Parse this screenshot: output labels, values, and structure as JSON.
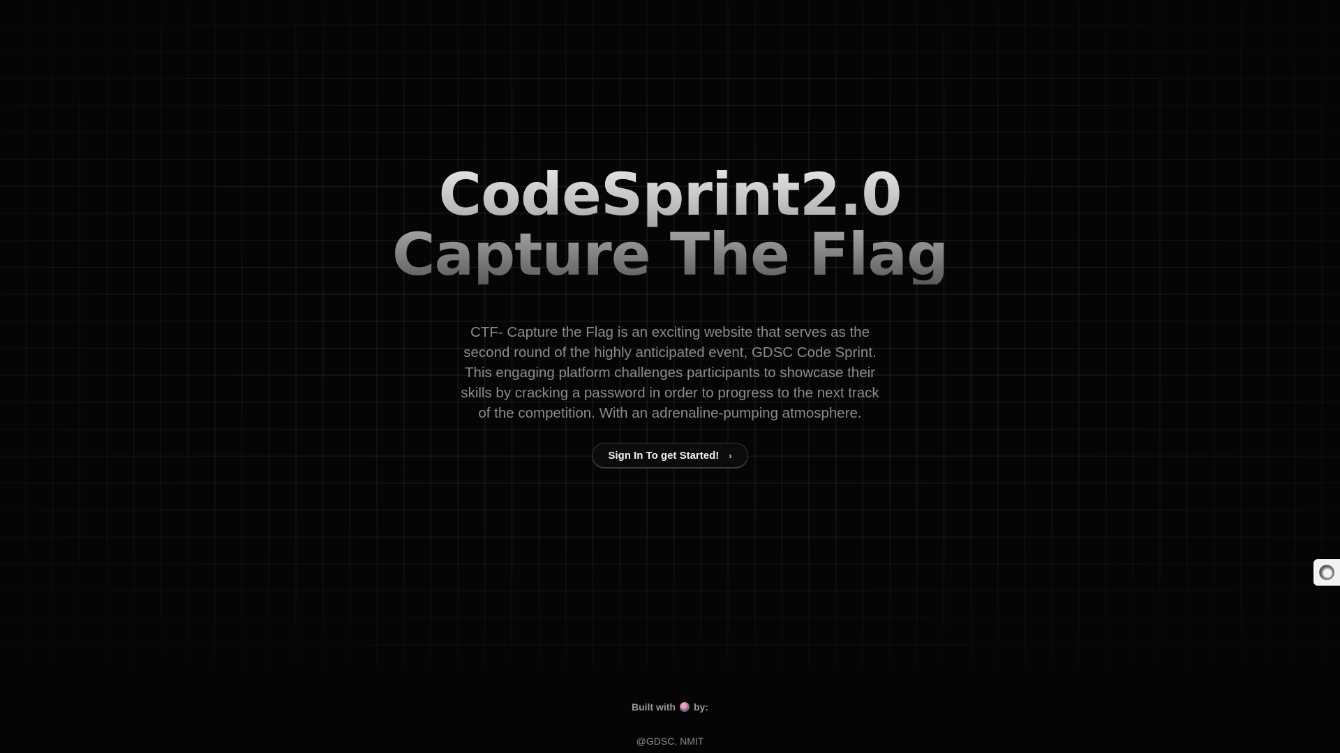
{
  "hero": {
    "title_line1": "CodeSprint2.0",
    "title_line2": "Capture The Flag",
    "description": "CTF- Capture the Flag is an exciting website that serves as the second round of the highly anticipated event, GDSC Code Sprint. This engaging platform challenges participants to showcase their skills by cracking a password in order to progress to the next track of the competition. With an adrenaline-pumping atmosphere.",
    "cta_label": "Sign In To get Started!",
    "cta_icon": "chevron-right-icon"
  },
  "footer": {
    "built_with": "Built with",
    "by": "by:",
    "heart_icon": "heart-icon",
    "org": "@GDSC, NMIT"
  },
  "side_widget": {
    "icon": "circle-widget-icon"
  },
  "colors": {
    "background": "#050505",
    "text_muted": "#8b8b8b",
    "accent_glow": "#5ac896"
  }
}
